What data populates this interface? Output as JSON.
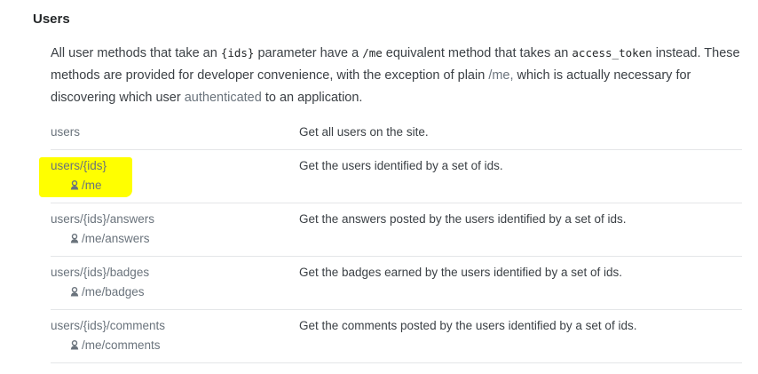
{
  "section": {
    "title": "Users"
  },
  "intro": {
    "t1": "All user methods that take an ",
    "code1": "{ids}",
    "t2": " parameter have a ",
    "code2": "/me",
    "t3": " equivalent method that takes an ",
    "code3": "access_token",
    "t4": " instead. These methods are provided for developer convenience, with the exception of plain ",
    "link_me": "/me,",
    "t5": " which is actually necessary for discovering which user ",
    "link_auth": "authenticated",
    "t6": " to an application."
  },
  "methods": [
    {
      "path": "users",
      "me": "",
      "desc": "Get all users on the site."
    },
    {
      "path": "users/{ids}",
      "me": "/me",
      "desc": "Get the users identified by a set of ids."
    },
    {
      "path": "users/{ids}/answers",
      "me": "/me/answers",
      "desc": "Get the answers posted by the users identified by a set of ids."
    },
    {
      "path": "users/{ids}/badges",
      "me": "/me/badges",
      "desc": "Get the badges earned by the users identified by a set of ids."
    },
    {
      "path": "users/{ids}/comments",
      "me": "/me/comments",
      "desc": "Get the comments posted by the users identified by a set of ids."
    }
  ],
  "colors": {
    "highlight": "#ffff00",
    "link": "#6a737c",
    "text": "#3b4045",
    "divider": "#e4e6e8"
  },
  "icons": {
    "me_icon": "person-icon"
  }
}
